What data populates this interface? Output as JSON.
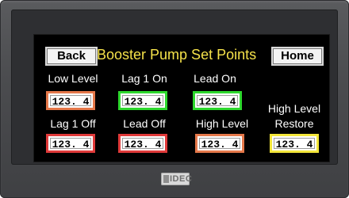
{
  "title": "Booster Pump Set Points",
  "buttons": {
    "back": "Back",
    "home": "Home"
  },
  "setpoints": [
    {
      "label": "Low Level",
      "value": "123. 4",
      "color": "#e5784a"
    },
    {
      "label": "Lag 1 On",
      "value": "123. 4",
      "color": "#2ed82e"
    },
    {
      "label": "Lead On",
      "value": "123. 4",
      "color": "#2ed82e"
    },
    {
      "label": "Lag 1 Off",
      "value": "123. 4",
      "color": "#e03a3a"
    },
    {
      "label": "Lead Off",
      "value": "123. 4",
      "color": "#e03a3a"
    },
    {
      "label": "High Level",
      "value": "123. 4",
      "color": "#e5784a"
    },
    {
      "label": "High Level",
      "value": "123. 4",
      "color": "#f3e63a"
    }
  ],
  "restore_label": "Restore",
  "logo": {
    "text": "IDEC"
  }
}
